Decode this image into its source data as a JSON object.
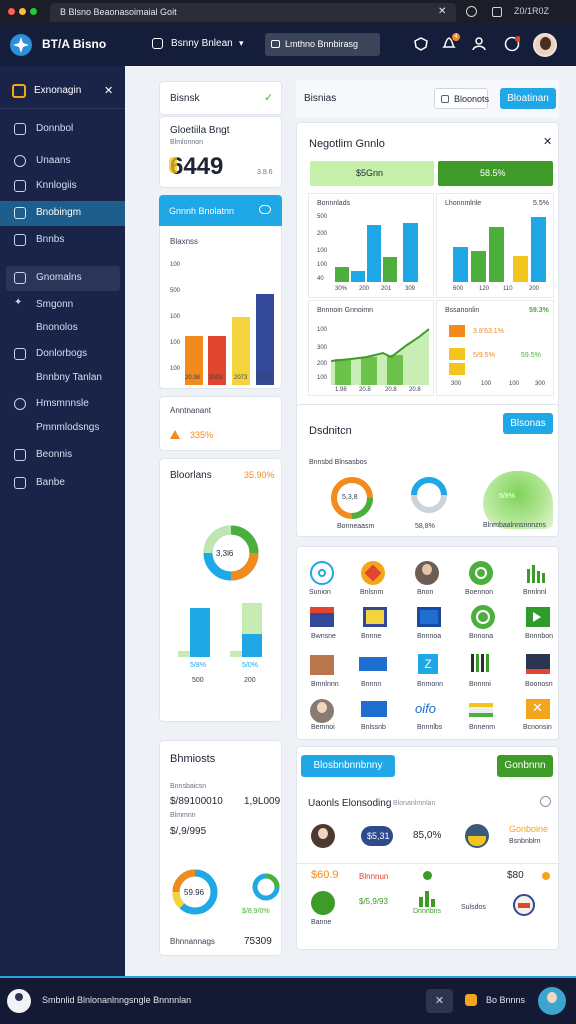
{
  "window": {
    "tab_title": "B Blsno Beaonasoimaial Goit",
    "close_glyph": "✕",
    "ctrl_right": "Z0/1R0Z",
    "dot_colors": [
      "#ff5f57",
      "#febc2e",
      "#28c840"
    ]
  },
  "topbar": {
    "app_name": "BT/A Bisno",
    "workspace": "Bsnny Bnlean",
    "workspace_caret": "▾",
    "search_label": "Lmthno Bnnbirasg",
    "notify_badge": "4"
  },
  "sidebar": {
    "header": "Exnonagin",
    "close": "✕",
    "items": [
      {
        "label": "Donnbol",
        "icon": "monitor-icon"
      },
      {
        "label": "Unaans",
        "icon": "sparkle-icon"
      },
      {
        "label": "Knnlogiis",
        "icon": "swap-icon"
      },
      {
        "label": "Bnobingm",
        "icon": "chat-icon",
        "active": true
      },
      {
        "label": "Bnnbs",
        "icon": "card-icon"
      },
      {
        "label": "Gnomalns",
        "icon": "users-icon",
        "group": true
      },
      {
        "label": "Smgonn",
        "icon": "spark-icon"
      },
      {
        "label": "Bnonolos",
        "icon": ""
      },
      {
        "label": "Donlorbogs",
        "icon": "grid-icon"
      },
      {
        "label": "Bnnbny Tanlan",
        "icon": ""
      },
      {
        "label": "Hmsmnnsle",
        "icon": "globe-icon"
      },
      {
        "label": "Pmnmlodsngs",
        "icon": ""
      },
      {
        "label": "Beonnis",
        "icon": "chart-icon"
      },
      {
        "label": "Banbe",
        "icon": "list-icon"
      }
    ]
  },
  "left_col": {
    "card1": {
      "title": "Bisnsk",
      "check": "✓"
    },
    "card2": {
      "title": "Gloetiila Bngt",
      "subtitle": "Blmlonnon",
      "big_number": "6449",
      "small": "3.8.6"
    },
    "card3": {
      "header": "Gnnnh Bnolatnn",
      "header_icon": "cloud-icon",
      "label": "Blaxnss",
      "yticks": [
        "100",
        "500",
        "100",
        "100",
        "100"
      ],
      "xlabels": [
        "20.98",
        "2003",
        "2073",
        "20/88"
      ]
    },
    "card4": {
      "title": "Anntnanant",
      "value": "335%"
    },
    "card5": {
      "title": "Bloorlans",
      "value": "35.90%",
      "donut_value": "3,3l6",
      "bar_labels": [
        "5/8%",
        "5/0%"
      ],
      "bar_ticks": [
        "500",
        "200"
      ]
    },
    "card6": {
      "title": "Bhmiosts",
      "row1_label": "Bnnsbaicsn",
      "row1_a": "$/89100010",
      "row1_b": "1,9L009",
      "row2_label": "Blmmnn",
      "row2_val": "$/,9/995",
      "donut_value": "59.96",
      "donut2_value": "",
      "donut2_cap": "$/8,9/0%",
      "foot_label": "Bhnnannags",
      "foot_value": "75309"
    }
  },
  "right_col": {
    "top": {
      "title": "Bisnias",
      "btn_secondary": "Bloonots",
      "btn_primary": "Bloatinan"
    },
    "panel": {
      "title": "Negotlim Gnnlo",
      "close": "✕",
      "tag1": "$5Gnn",
      "tag2": "58.5%",
      "chartA": {
        "title": "Bonnnlads",
        "yticks": [
          "500",
          "200",
          "100",
          "100",
          "40",
          "20"
        ],
        "xlabels": [
          "30%",
          "200",
          "201",
          "309"
        ]
      },
      "chartB": {
        "title": "Lhonnmlnle",
        "value": "5.5%",
        "xlabels": [
          "600",
          "120",
          "110",
          "200"
        ]
      },
      "chartC": {
        "title": "Bnnnoin Gnnoimn",
        "yticks": [
          "100",
          "300",
          "200",
          "100"
        ],
        "xlabels": [
          "1.98",
          "20.8",
          "20.8",
          "20.8"
        ]
      },
      "chartD": {
        "title": "Bssanonlin",
        "value": "59.3%",
        "row1": "3.8'63.1%",
        "row2": "5/9.5%",
        "row2_val": "59.5%",
        "xlabels": [
          "300",
          "100",
          "100",
          "300"
        ]
      }
    },
    "dist": {
      "title": "Dsdnitcn",
      "btn": "Blsonas",
      "sub": "Bnnsbd Blnsasbos",
      "donut1": "5,3,8",
      "donut1_cap": "Bonneaasm",
      "donut2": "",
      "donut2_cap": "58,8%",
      "blob_label": "5/8%",
      "blob_cap": "Blnmbaalnnsnnnzns"
    },
    "icons": {
      "captions": [
        "Sunion",
        "Bnlsnm",
        "Bnon",
        "Boennon",
        "Bnnlnnl",
        "Bwnsne",
        "Bnnne",
        "Bnnnoa",
        "Bnnona",
        "Bnnnbon",
        "Bmnlnnn",
        "Bnnnn",
        "Bnmonn",
        "Bnnnni",
        "Boonosn",
        "Bemnoi",
        "Bnlssnb",
        "Bnnnlbs",
        "Bnnenm",
        "Bcnonsin"
      ]
    },
    "bottom": {
      "btn1": "Blosbnbnnbnny",
      "btn2": "Gonbnnn",
      "title": "Uaonls Elonsoding",
      "title_sub": "Blonanlmnlan",
      "avatar_tag": "$5,31",
      "pct": "85,0%",
      "right_title": "Gonboine",
      "right_sub": "Bsnbnblrn",
      "row2_val": "$60.9",
      "row2_tag": "Blnnnun",
      "row2_right": "$80",
      "row3_a": "$/5,9/93",
      "row3_b": "Dnnnbns",
      "row3_c": "Sulsdos",
      "row3_cap": "Banne"
    }
  },
  "bottombar": {
    "status": "Smbnlid Blnlonanlnngsngle Bnnnnlan",
    "right_label": "Bo Bnnns"
  },
  "colors": {
    "accent": "#1fa7e6",
    "green": "#4caf3b",
    "orange": "#f28b1b",
    "red": "#e2452d",
    "yellow": "#f3d43c",
    "navy": "#34489a",
    "sidebar": "#1a2448"
  }
}
